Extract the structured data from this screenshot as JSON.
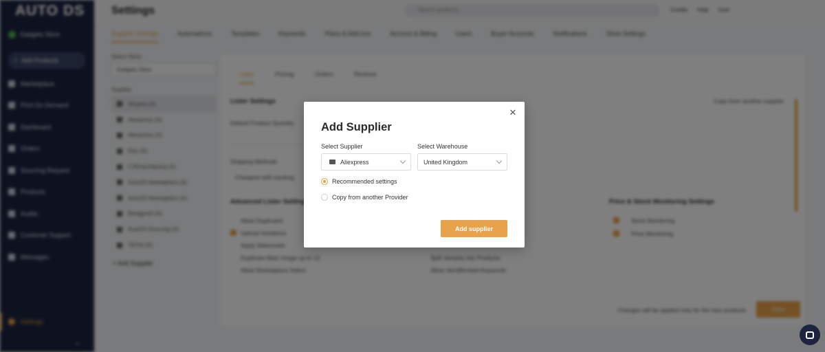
{
  "app": {
    "logo": "AUTO DS",
    "store_name": "Gadgets Store",
    "add_products": "Add Products",
    "nav": [
      "Marketplace",
      "Print On Demand",
      "Dashboard",
      "Orders",
      "Sourcing Request",
      "Products",
      "Audits",
      "Customer Support",
      "Messages"
    ],
    "settings": "Settings"
  },
  "topbar": {
    "title": "Settings",
    "search_placeholder": "Search products",
    "meta": [
      "Credits",
      "Help",
      "User"
    ]
  },
  "settings_tabs": [
    "Supplier Settings",
    "Automations",
    "Templates",
    "Keywords",
    "Plans & Add-ons",
    "Account & Billing",
    "Users",
    "Buyer Accounts",
    "Notifications",
    "Store Settings"
  ],
  "left_panel": {
    "store_label": "Select Store",
    "store_value": "Gadgets Store",
    "suppliers_label": "Supplier",
    "suppliers": [
      "Shopee (A)",
      "Aliexpress (A)",
      "Aliexpress (A)",
      "Etsy (A)",
      "CJDropshipping (A)",
      "AutoDS Marketplace (A)",
      "AutoDS Marketplace (A)",
      "Banggood (A)",
      "AutoDS Sourcing (A)",
      "TikTok (A)"
    ],
    "add_supplier": "Add Supplier"
  },
  "right_panel": {
    "tabs": [
      "Lister",
      "Pricing",
      "Orders",
      "Restock"
    ],
    "lister_settings": "Lister Settings",
    "copy_from": "Copy from another supplier",
    "default_qty": "Default Product Quantity",
    "shipping_methods": "Shipping Methods",
    "shipping_value": "Cheapest with tracking",
    "advanced": "Advanced Lister Settings",
    "adv_items": [
      "Allow Duplicates",
      "Upload Variations",
      "Apply Watermark",
      "Duplicate Main Image up to 12",
      "Allow Marketplace Select"
    ],
    "mid_items": [
      "Split Variants into Products",
      "Allow VeroBlocked Keywords"
    ],
    "price_stock": "Price & Stock Monitoring Settings",
    "ps_items": [
      "Stock Monitoring",
      "Price Monitoring"
    ],
    "footer_note": "Changes will be applied only for the new products",
    "save": "Save"
  },
  "modal": {
    "title": "Add Supplier",
    "supplier_label": "Select Supplier",
    "supplier_value": "Aliexpress",
    "warehouse_label": "Select Warehouse",
    "warehouse_value": "United Kingdom",
    "option_recommended": "Recommended settings",
    "option_copy": "Copy from another Provider",
    "selected_option": "recommended",
    "submit": "Add supplier",
    "accent_color": "#e8a24a"
  }
}
